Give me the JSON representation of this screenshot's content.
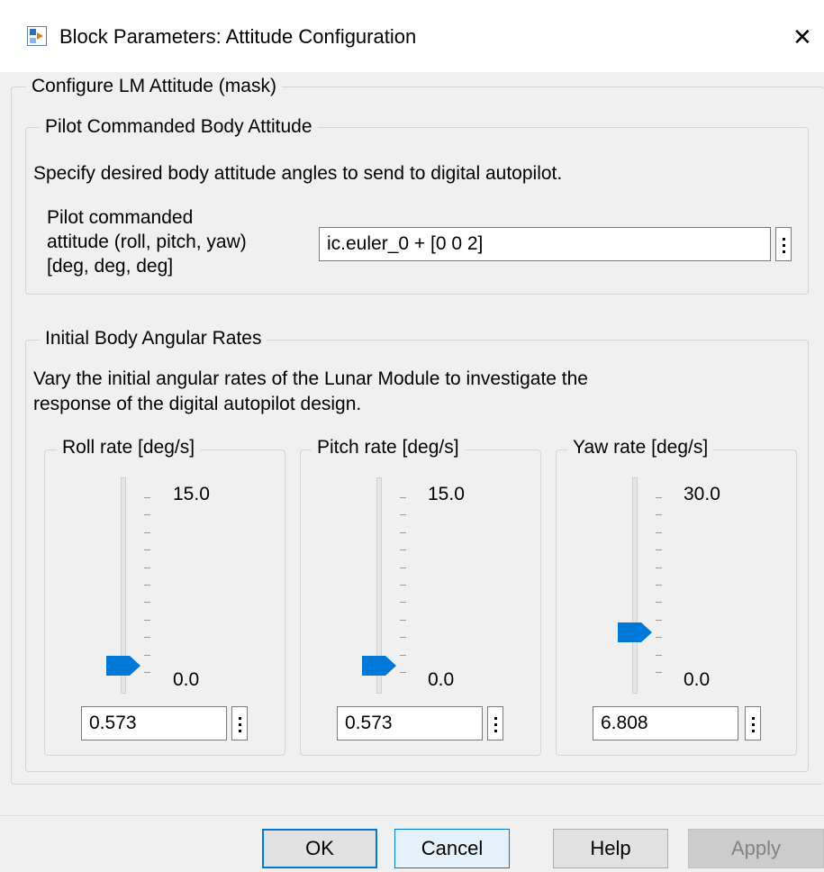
{
  "window": {
    "title": "Block Parameters: Attitude Configuration",
    "close_glyph": "✕"
  },
  "mask": {
    "title": "Configure LM Attitude (mask)"
  },
  "pilot_group": {
    "title": "Pilot Commanded Body Attitude",
    "description": "Specify desired body attitude angles to send to digital autopilot.",
    "param_label_lines": [
      "Pilot commanded",
      "attitude (roll, pitch, yaw)",
      "[deg, deg, deg]"
    ],
    "param_value": "ic.euler_0 + [0 0 2]"
  },
  "rates_group": {
    "title": "Initial Body Angular Rates",
    "description_lines": [
      "Vary the initial angular rates of the Lunar Module to investigate the",
      "response of the digital autopilot design."
    ],
    "sliders": [
      {
        "title": "Roll rate [deg/s]",
        "max_label": "15.0",
        "min_label": "0.0",
        "value": "0.573",
        "min": 0,
        "max": 15.0,
        "level": 0.573
      },
      {
        "title": "Pitch rate [deg/s]",
        "max_label": "15.0",
        "min_label": "0.0",
        "value": "0.573",
        "min": 0,
        "max": 15.0,
        "level": 0.573
      },
      {
        "title": "Yaw rate [deg/s]",
        "max_label": "30.0",
        "min_label": "0.0",
        "value": "6.808",
        "min": 0,
        "max": 30.0,
        "level": 6.808
      }
    ]
  },
  "buttons": {
    "ok": "OK",
    "cancel": "Cancel",
    "help": "Help",
    "apply": "Apply"
  },
  "colors": {
    "accent": "#0078d7",
    "thumb": "#0078d7"
  },
  "icons": {
    "app": "simulink-block-icon",
    "more": "vertical-ellipsis-icon"
  }
}
